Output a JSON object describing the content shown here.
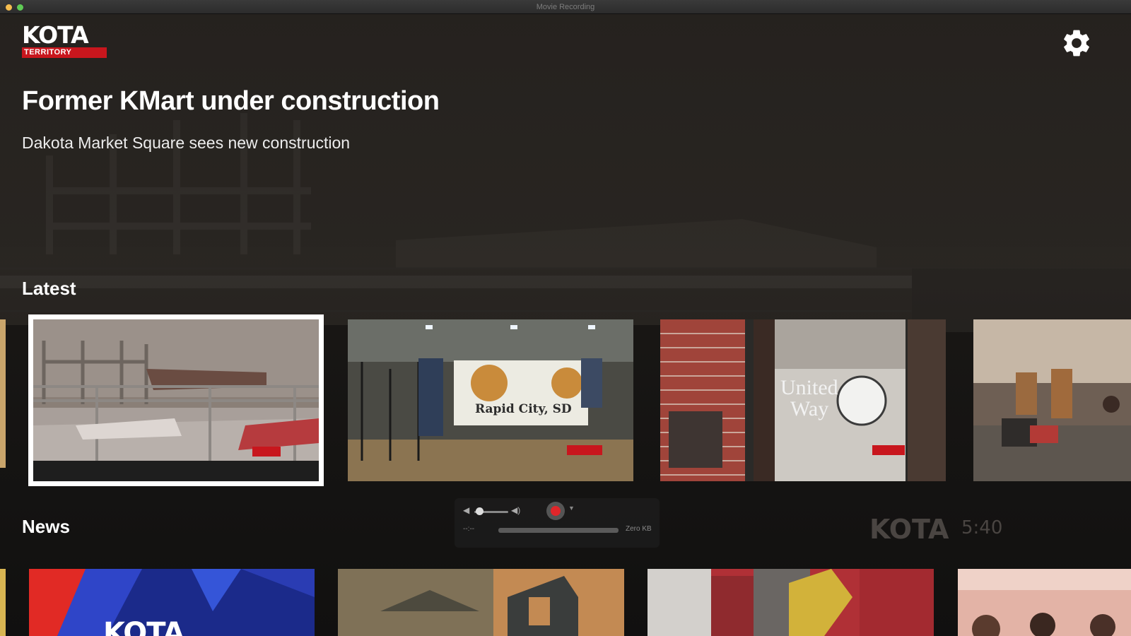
{
  "window": {
    "title": "Movie Recording"
  },
  "header": {
    "logo_main": "KOTA",
    "logo_sub": "TERRITORY"
  },
  "hero": {
    "title": "Former KMart under construction",
    "subtitle": "Dakota Market Square sees new construction"
  },
  "sections": {
    "latest": {
      "title": "Latest",
      "items": [
        {
          "name": "construction-site",
          "focused": true
        },
        {
          "name": "rodeo-arena-banner",
          "banner_text": "Rapid City, SD"
        },
        {
          "name": "united-way-door",
          "sign_line1": "United",
          "sign_line2": "Way"
        },
        {
          "name": "classroom"
        }
      ]
    },
    "news": {
      "title": "News",
      "items": [
        {
          "name": "kota-graphic",
          "text": "KOTA"
        },
        {
          "name": "storefront"
        },
        {
          "name": "fire-truck"
        },
        {
          "name": "group-photo"
        }
      ]
    }
  },
  "recording_panel": {
    "timer": "--:--",
    "size": "Zero KB"
  },
  "watermark": {
    "logo": "KOTA",
    "time": "5:40"
  },
  "colors": {
    "accent": "#c8161d",
    "focus": "#ffffff",
    "record": "#e0262a"
  }
}
